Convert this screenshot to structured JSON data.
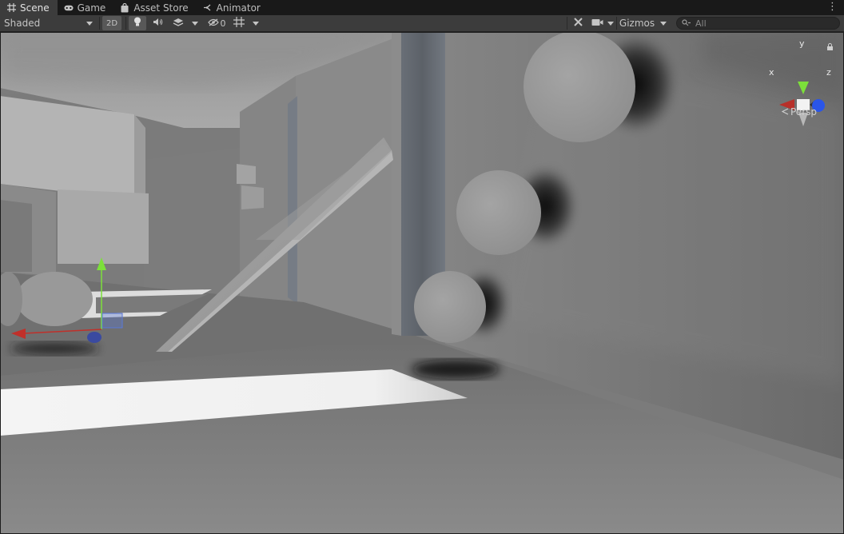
{
  "tabs": [
    {
      "label": "Scene",
      "icon": "grid-icon",
      "active": true
    },
    {
      "label": "Game",
      "icon": "gamepad-icon",
      "active": false
    },
    {
      "label": "Asset Store",
      "icon": "shopping-bag-icon",
      "active": false
    },
    {
      "label": "Animator",
      "icon": "animator-icon",
      "active": false
    }
  ],
  "toolbar": {
    "draw_mode": "Shaded",
    "mode_2d_label": "2D",
    "hidden_count": "0",
    "gizmos_label": "Gizmos",
    "search_placeholder": "All"
  },
  "gizmo": {
    "x_label": "x",
    "y_label": "y",
    "z_label": "z",
    "projection_label": "Persp"
  },
  "colors": {
    "tab_bar_bg": "#191919",
    "toolbar_bg": "#3c3c3c",
    "active_tab_bg": "#3c3c3c",
    "axis_x": "#c0302a",
    "axis_y": "#7ce03a",
    "axis_z": "#2a55e8"
  }
}
